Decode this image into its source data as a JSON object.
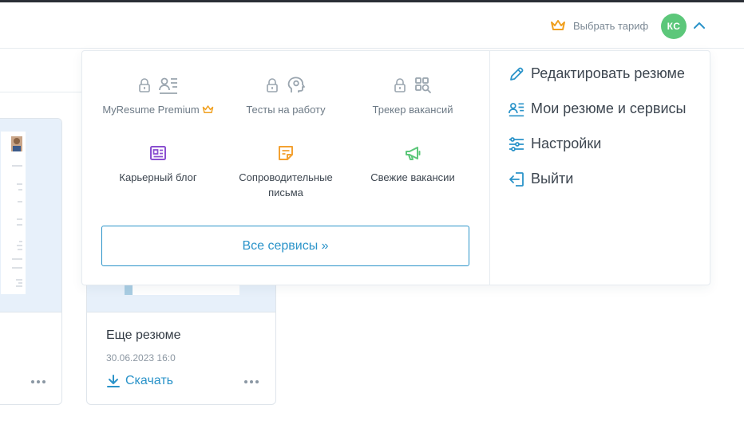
{
  "header": {
    "tariff_label": "Выбрать тариф",
    "avatar_initials": "КС"
  },
  "menu": {
    "services": [
      {
        "label": "MyResume Premium",
        "locked": true,
        "icon": "profile-card-icon"
      },
      {
        "label": "Тесты на работу",
        "locked": true,
        "icon": "head-gear-icon"
      },
      {
        "label": "Трекер вакансий",
        "locked": true,
        "icon": "search-grid-icon"
      },
      {
        "label": "Карьерный блог",
        "locked": false,
        "icon": "newspaper-icon"
      },
      {
        "label": "Сопроводительные письма",
        "locked": false,
        "icon": "note-icon"
      },
      {
        "label": "Свежие вакансии",
        "locked": false,
        "icon": "megaphone-icon"
      }
    ],
    "all_services_label": "Все сервисы »",
    "links": [
      {
        "label": "Редактировать резюме",
        "icon": "pencil-icon"
      },
      {
        "label": "Мои резюме и сервисы",
        "icon": "profile-list-icon"
      },
      {
        "label": "Настройки",
        "icon": "sliders-icon"
      },
      {
        "label": "Выйти",
        "icon": "logout-icon"
      }
    ]
  },
  "cards": [
    {
      "title": "Еще резюме",
      "date": "30.06.2023 16:0",
      "download_label": "Скачать"
    }
  ],
  "colors": {
    "accent": "#2a93c9",
    "avatar": "#5cc77a",
    "crown": "#f0a020",
    "purple": "#8a4fd0",
    "orange": "#f3a132",
    "green": "#5cc77a"
  }
}
